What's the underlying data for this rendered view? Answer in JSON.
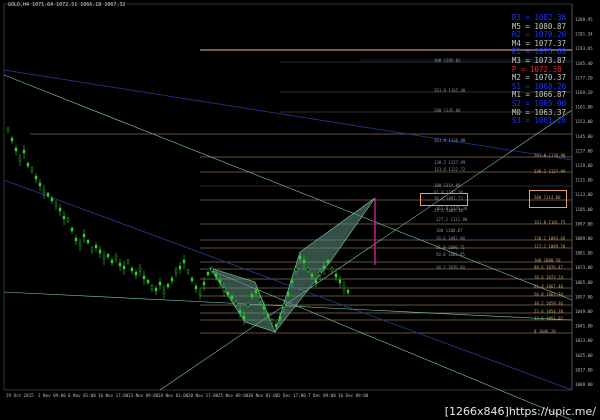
{
  "header": {
    "symbol_line": "GOLD,H4  1071.64 1072.51 1066.18 1067.32"
  },
  "pivots": [
    {
      "label": "R3 = 1082.38",
      "color": "#1e32ff"
    },
    {
      "label": "M5 = 1080.87",
      "color": "#c8c8c8"
    },
    {
      "label": "R2 = 1079.26",
      "color": "#1e32ff"
    },
    {
      "label": "M4 = 1077.37",
      "color": "#c8c8c8"
    },
    {
      "label": "R1 = 1075.68",
      "color": "#1e32ff"
    },
    {
      "label": "M3 = 1073.87",
      "color": "#c8c8c8"
    },
    {
      "label": "P  = 1072.38",
      "color": "#ff1a1a"
    },
    {
      "label": "M2 = 1070.37",
      "color": "#c8c8c8"
    },
    {
      "label": "S1 = 1068.26",
      "color": "#1e32ff"
    },
    {
      "label": "M1 = 1066.87",
      "color": "#c8c8c8"
    },
    {
      "label": "S2 = 1065.00",
      "color": "#1e32ff"
    },
    {
      "label": "M0 = 1063.37",
      "color": "#c8c8c8"
    },
    {
      "label": "S3 = 1061.26",
      "color": "#1e32ff"
    }
  ],
  "price_axis": [
    "1209.95",
    "1201.34",
    "1193.65",
    "1185.40",
    "1177.20",
    "1169.20",
    "1161.00",
    "1153.00",
    "1145.00",
    "1137.00",
    "1129.00",
    "1121.00",
    "1113.00",
    "1105.00",
    "1097.00",
    "1089.00",
    "1081.00",
    "1073.00",
    "1065.00",
    "1057.00",
    "1049.00",
    "1041.00",
    "1033.00",
    "1025.00",
    "1017.00",
    "1009.00"
  ],
  "time_axis": [
    "29 Oct 2015",
    "3 Nov 09:00",
    "6 Nov 01:00",
    "10 Nov 17:00",
    "13 Nov 09:00",
    "18 Nov 01:00",
    "20 Nov 17:00",
    "25 Nov 09:00",
    "30 Nov 01:00",
    "2 Dec 17:00",
    "7 Dec 09:00",
    "10 Dec 09:00"
  ],
  "fib_upper": [
    "300  1185.02",
    "261.8  1165.40",
    "200  1145.88",
    "161.8  1136.98",
    "138.2  1127.99",
    "123.6  1122.72",
    "100  1114.00",
    "61.8  1102.70",
    "38.2  1091.73",
    "23.6  1083.30"
  ],
  "fib_right": [
    "261.8  1136.90",
    "238.2  1127.99",
    "200  1114.00",
    "161.8  1101.75",
    "138.2  1093.69",
    "127.2  1089.70",
    "100  1080.58",
    "88.6  1076.47",
    "78.6  1073.24",
    "61.8  1067.40",
    "50.0  1063.78",
    "38.2  1059.36",
    "23.6  1054.38",
    "13.6  1051.02",
    "0  1046.28"
  ],
  "fib_mid": [
    "161.8  1125.36",
    "127.2  1111.80",
    "100  1100.87",
    "78.6  1092.80",
    "61.8  1086.71",
    "50.0  1082.85",
    "38.2  1076.84"
  ],
  "watermark": "[1266x846]https://upic.me/",
  "colors": {
    "candle": "#2fd12f",
    "trend": "#7fd0b0",
    "channel": "#2a3aa0",
    "fib": "#c9a36a",
    "pattern": "#5f8f7f",
    "arrow": "#d02090"
  }
}
